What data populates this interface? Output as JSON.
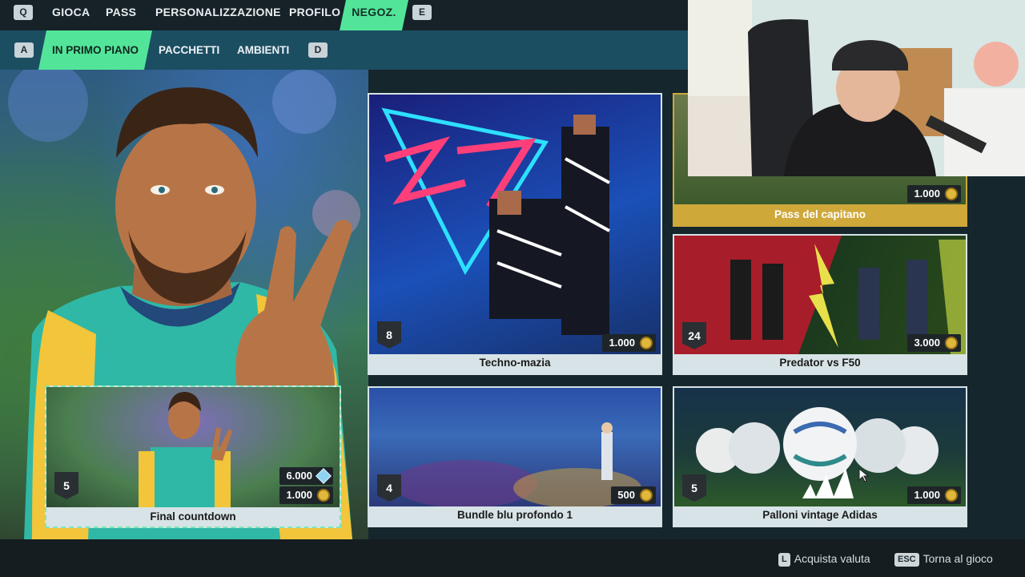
{
  "top_nav": {
    "left_key": "Q",
    "right_key": "E",
    "items": [
      "GIOCA",
      "PASS",
      "PERSONALIZZAZIONE",
      "PROFILO",
      "NEGOZ."
    ],
    "active": "NEGOZ."
  },
  "sub_nav": {
    "left_key": "A",
    "right_key": "D",
    "items": [
      "IN PRIMO PIANO",
      "PACCHETTI",
      "AMBIENTI"
    ],
    "active": "IN PRIMO PIANO"
  },
  "featured": {
    "title": "Final countdown",
    "count": "5",
    "price_gems": "6.000",
    "price_coins": "1.000"
  },
  "cards": [
    {
      "title": "Techno-mazia",
      "count": "8",
      "price": "1.000"
    },
    {
      "title": "Pass del capitano",
      "price": "1.000"
    },
    {
      "title": "Predator vs F50",
      "count": "24",
      "price": "3.000"
    },
    {
      "title": "Bundle blu profondo 1",
      "count": "4",
      "price": "500"
    },
    {
      "title": "Palloni vintage Adidas",
      "count": "5",
      "price": "1.000"
    }
  ],
  "footer": {
    "buy_key": "L",
    "buy_label": "Acquista valuta",
    "back_key": "ESC",
    "back_label": "Torna al gioco"
  },
  "colors": {
    "accent_green": "#52e59a",
    "sub_bar": "#1c4e62",
    "card_frame": "#d7e3e6",
    "gold_frame": "#cfa83a"
  },
  "icons": [
    "coin-icon",
    "gem-icon",
    "cursor-icon"
  ]
}
